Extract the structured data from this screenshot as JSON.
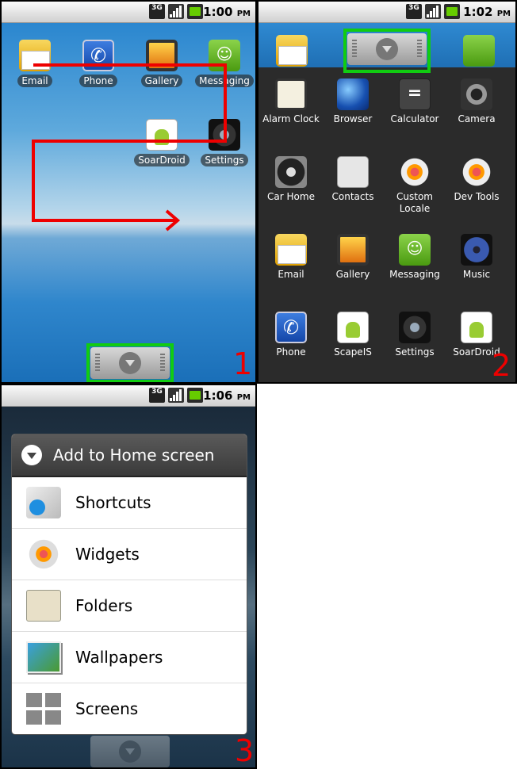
{
  "panels": [
    {
      "number": "1",
      "status_time": "1:00",
      "apps": [
        {
          "label": "Email",
          "icon": "email-icon"
        },
        {
          "label": "Phone",
          "icon": "phone-icon"
        },
        {
          "label": "Gallery",
          "icon": "gallery-icon"
        },
        {
          "label": "Messaging",
          "icon": "messaging-icon"
        },
        {
          "label": "SoarDroid",
          "icon": "android-app-icon"
        },
        {
          "label": "Settings",
          "icon": "settings-icon"
        }
      ]
    },
    {
      "number": "2",
      "status_time": "1:02",
      "apps": [
        {
          "label": "Alarm Clock",
          "icon": "clock-icon"
        },
        {
          "label": "Browser",
          "icon": "globe-icon"
        },
        {
          "label": "Calculator",
          "icon": "calculator-icon"
        },
        {
          "label": "Camera",
          "icon": "camera-icon"
        },
        {
          "label": "Car Home",
          "icon": "car-home-icon"
        },
        {
          "label": "Contacts",
          "icon": "contacts-icon"
        },
        {
          "label": "Custom Locale",
          "icon": "gear-icon"
        },
        {
          "label": "Dev Tools",
          "icon": "gear-icon"
        },
        {
          "label": "Email",
          "icon": "email-icon"
        },
        {
          "label": "Gallery",
          "icon": "gallery-icon"
        },
        {
          "label": "Messaging",
          "icon": "messaging-icon"
        },
        {
          "label": "Music",
          "icon": "speaker-icon"
        },
        {
          "label": "Phone",
          "icon": "phone-icon"
        },
        {
          "label": "ScapeIS",
          "icon": "android-app-icon"
        },
        {
          "label": "Settings",
          "icon": "settings-icon"
        },
        {
          "label": "SoarDroid",
          "icon": "android-app-icon"
        }
      ]
    },
    {
      "number": "3",
      "status_time": "1:06",
      "menu_title": "Add to Home screen",
      "menu_items": [
        {
          "label": "Shortcuts",
          "icon": "shortcut-arrow-icon"
        },
        {
          "label": "Widgets",
          "icon": "gear-icon"
        },
        {
          "label": "Folders",
          "icon": "folder-icon"
        },
        {
          "label": "Wallpapers",
          "icon": "picture-icon"
        },
        {
          "label": "Screens",
          "icon": "grid-icon"
        }
      ]
    }
  ],
  "status": {
    "network": "3G",
    "am_pm": "PM"
  },
  "colors": {
    "annotation_red": "#e00000",
    "highlight_green": "#11cc11"
  }
}
